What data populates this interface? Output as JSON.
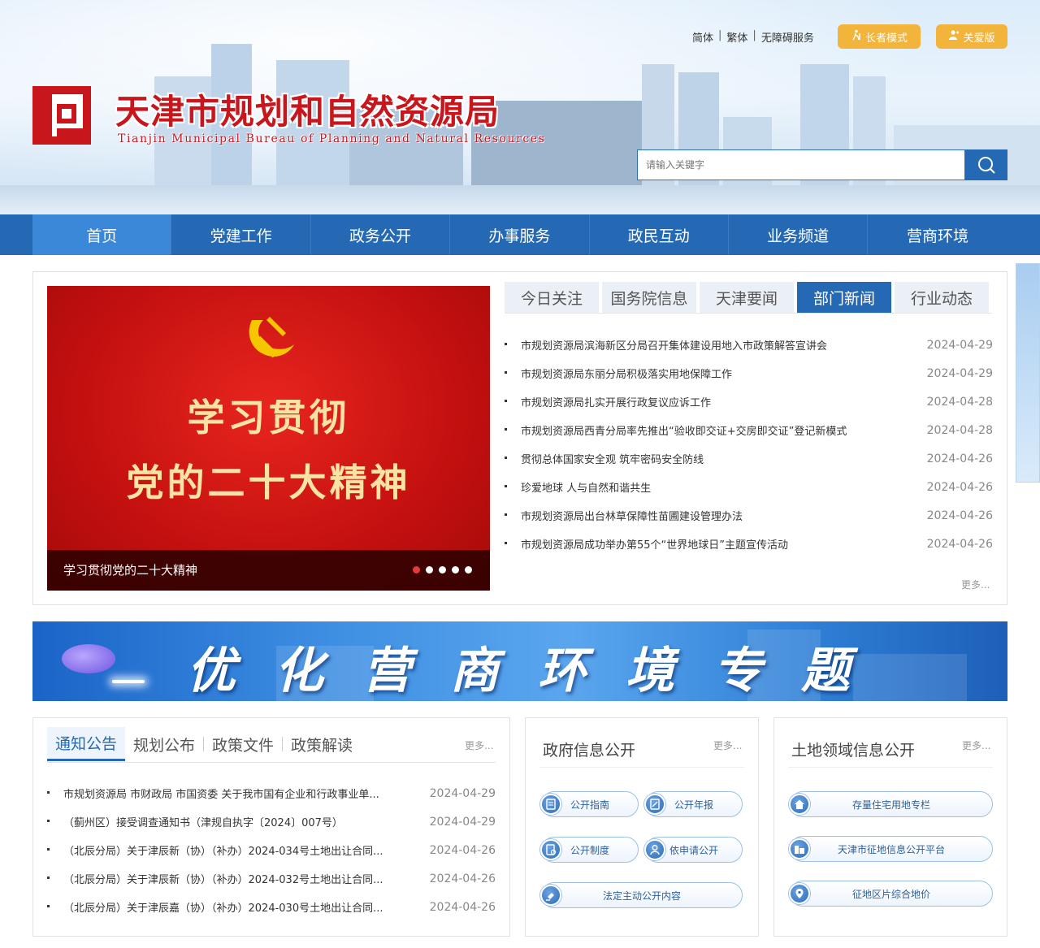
{
  "header": {
    "lang_simplified": "简体",
    "lang_traditional": "繁体",
    "separator": "|",
    "accessibility": "无障碍服务",
    "elder_mode": "长者模式",
    "care_version": "关爱版",
    "site_title": "天津市规划和自然资源局",
    "site_subtitle": "Tianjin Municipal Bureau of Planning and Natural Resources",
    "search_placeholder": "请输入关键字"
  },
  "nav": {
    "items": [
      "首页",
      "党建工作",
      "政务公开",
      "办事服务",
      "政民互动",
      "业务频道",
      "营商环境"
    ],
    "active_index": 0
  },
  "slider": {
    "line1": "学习贯彻",
    "line2": "党的二十大精神",
    "caption": "学习贯彻党的二十大精神",
    "dot_count": 5,
    "active_dot": 0
  },
  "news": {
    "tabs": [
      "今日关注",
      "国务院信息",
      "天津要闻",
      "部门新闻",
      "行业动态"
    ],
    "active_tab": 3,
    "items": [
      {
        "title": "市规划资源局滨海新区分局召开集体建设用地入市政策解答宣讲会",
        "date": "2024-04-29"
      },
      {
        "title": "市规划资源局东丽分局积极落实用地保障工作",
        "date": "2024-04-29"
      },
      {
        "title": "市规划资源局扎实开展行政复议应诉工作",
        "date": "2024-04-28"
      },
      {
        "title": "市规划资源局西青分局率先推出“验收即交证+交房即交证”登记新模式",
        "date": "2024-04-28"
      },
      {
        "title": "贯彻总体国家安全观 筑牢密码安全防线",
        "date": "2024-04-26"
      },
      {
        "title": "珍爱地球 人与自然和谐共生",
        "date": "2024-04-26"
      },
      {
        "title": "市规划资源局出台林草保障性苗圃建设管理办法",
        "date": "2024-04-26"
      },
      {
        "title": "市规划资源局成功举办第55个“世界地球日”主题宣传活动",
        "date": "2024-04-26"
      }
    ],
    "more": "更多..."
  },
  "banner": {
    "text": "优化营商环境专题"
  },
  "notices": {
    "tabs": [
      "通知公告",
      "规划公布",
      "政策文件",
      "政策解读"
    ],
    "active_tab": 0,
    "more": "更多...",
    "items": [
      {
        "title": "市规划资源局 市财政局 市国资委 关于我市国有企业和行政事业单...",
        "date": "2024-04-29"
      },
      {
        "title": "（蓟州区）接受调查通知书（津规自执字〔2024〕007号）",
        "date": "2024-04-29"
      },
      {
        "title": "（北辰分局）关于津辰新（协）（补办）2024-034号土地出让合同...",
        "date": "2024-04-26"
      },
      {
        "title": "（北辰分局）关于津辰新（协）（补办）2024-032号土地出让合同...",
        "date": "2024-04-26"
      },
      {
        "title": "（北辰分局）关于津辰嘉（协）（补办）2024-030号土地出让合同...",
        "date": "2024-04-26"
      }
    ]
  },
  "gov_info": {
    "title": "政府信息公开",
    "more": "更多...",
    "links": [
      {
        "label": "公开指南",
        "icon": "guide-icon"
      },
      {
        "label": "公开年报",
        "icon": "report-icon"
      },
      {
        "label": "公开制度",
        "icon": "rules-icon"
      },
      {
        "label": "依申请公开",
        "icon": "person-icon"
      },
      {
        "label": "法定主动公开内容",
        "icon": "gavel-icon"
      }
    ]
  },
  "land_info": {
    "title": "土地领域信息公开",
    "more": "更多...",
    "links": [
      {
        "label": "存量住宅用地专栏",
        "icon": "home-icon"
      },
      {
        "label": "天津市征地信息公开平台",
        "icon": "building-icon"
      },
      {
        "label": "征地区片综合地价",
        "icon": "location-icon"
      }
    ]
  },
  "colors": {
    "primary_blue": "#2568b4",
    "brand_red": "#c8161d",
    "mode_button": "#f2b43a"
  }
}
